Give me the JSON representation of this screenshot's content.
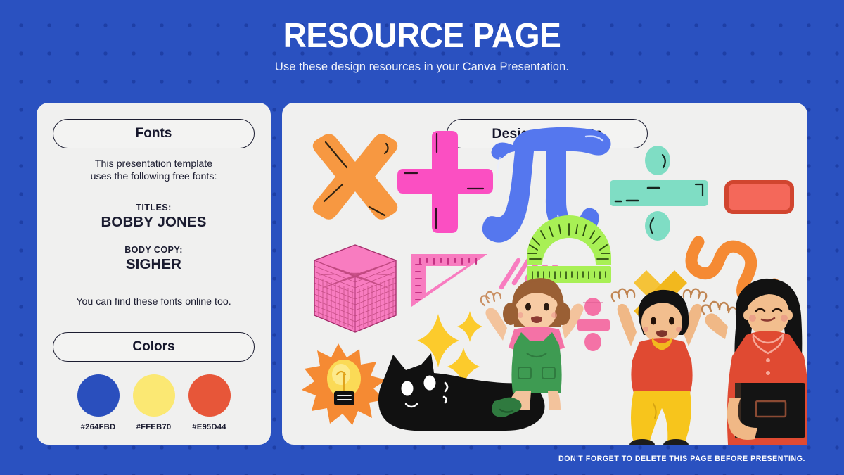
{
  "header": {
    "title": "RESOURCE PAGE",
    "subtitle": "Use these design resources in your Canva Presentation."
  },
  "left_card": {
    "fonts_pill_label": "Fonts",
    "intro_line1": "This presentation template",
    "intro_line2": "uses the following free fonts:",
    "titles_label": "TITLES:",
    "titles_font": "BOBBY JONES",
    "body_label": "BODY COPY:",
    "body_font": "SIGHER",
    "online_note": "You can find these fonts online too.",
    "colors_pill_label": "Colors",
    "swatches": [
      {
        "hex": "#264FBD",
        "color": "#2A4FBD"
      },
      {
        "hex": "#FFEB70",
        "color": "#FBE873"
      },
      {
        "hex": "#E95D44",
        "color": "#E75639"
      }
    ]
  },
  "right_card": {
    "design_pill_label": "Design Elements",
    "elements": [
      {
        "name": "multiply-x-icon",
        "color": "#F79841"
      },
      {
        "name": "plus-icon",
        "color": "#FB4FC2"
      },
      {
        "name": "pi-symbol-icon",
        "color": "#5577EE"
      },
      {
        "name": "divide-icon",
        "color": "#7FDDC4"
      },
      {
        "name": "minus-rectangle-icon",
        "color": "#F4685A"
      },
      {
        "name": "pink-cube-icon",
        "color": "#F87CC0"
      },
      {
        "name": "set-square-ruler-icon",
        "color": "#F87CC0"
      },
      {
        "name": "diagonal-strokes-icon",
        "color": "#F87CC0"
      },
      {
        "name": "protractor-icon",
        "color": "#A8F055"
      },
      {
        "name": "orange-squiggle-icon",
        "color": "#F58A33"
      },
      {
        "name": "sparkle-icon",
        "color": "#FCCB2C"
      },
      {
        "name": "lightbulb-burst-icon",
        "color": "#F58A33"
      },
      {
        "name": "black-cat-icon",
        "color": "#111111"
      },
      {
        "name": "girl-character-icon",
        "color": "#3E9B52"
      },
      {
        "name": "yellow-x-icon",
        "color": "#F2B81E"
      },
      {
        "name": "boy-character-icon",
        "color": "#E04A32"
      },
      {
        "name": "woman-character-icon",
        "color": "#E04A32"
      }
    ]
  },
  "footer": {
    "note": "DON'T FORGET TO DELETE THIS PAGE BEFORE PRESENTING."
  }
}
